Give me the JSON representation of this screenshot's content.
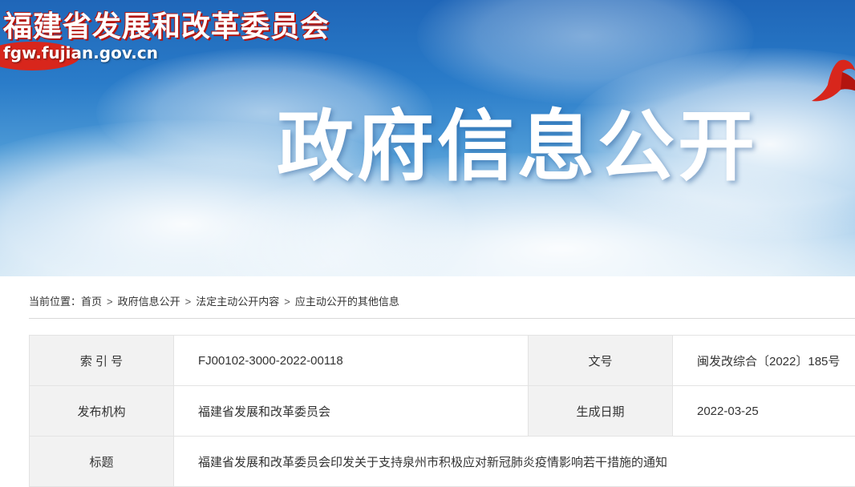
{
  "banner": {
    "site_name": "福建省发展和改革委员会",
    "site_domain": "fgw.fujian.gov.cn",
    "title": "政府信息公开"
  },
  "breadcrumb": {
    "prefix": "当前位置：",
    "items": [
      "首页",
      "政府信息公开",
      "法定主动公开内容",
      "应主动公开的其他信息"
    ],
    "separator": ">"
  },
  "info": {
    "index_label": "索 引 号",
    "index_value": "FJ00102-3000-2022-00118",
    "doc_no_label": "文号",
    "doc_no_value": "闽发改综合〔2022〕185号",
    "publisher_label": "发布机构",
    "publisher_value": "福建省发展和改革委员会",
    "date_label": "生成日期",
    "date_value": "2022-03-25",
    "title_label": "标题",
    "title_value": "福建省发展和改革委员会印发关于支持泉州市积极应对新冠肺炎疫情影响若干措施的通知"
  },
  "colors": {
    "brand_red": "#d8261c",
    "sky_blue": "#2a7cc9",
    "label_bg": "#f2f2f2"
  }
}
